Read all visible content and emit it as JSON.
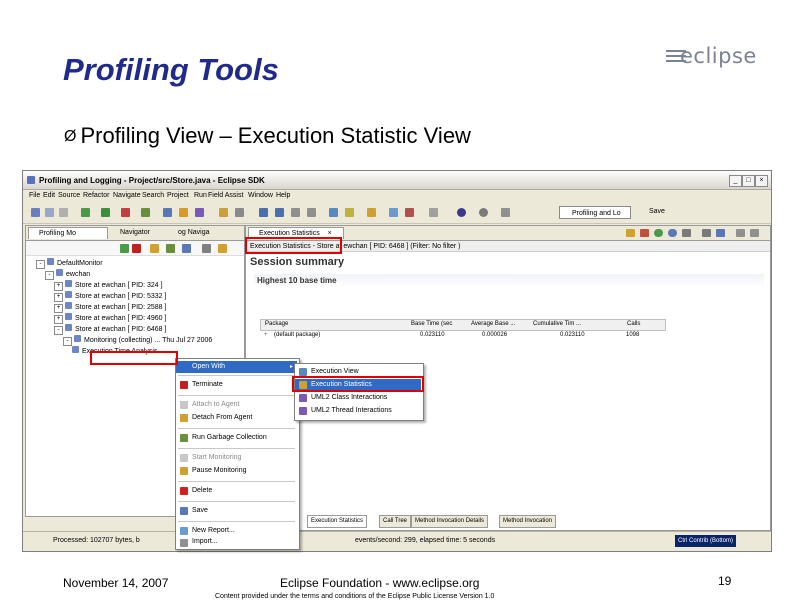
{
  "slide": {
    "title": "Profiling Tools",
    "logo_text": "eclipse",
    "bullet_marker": "Ø",
    "bullet": "Profiling View – Execution Statistic View"
  },
  "window": {
    "title": "Profiling and Logging - Project/src/Store.java - Eclipse SDK",
    "controls": [
      "_",
      "□",
      "×"
    ]
  },
  "menubar": [
    "File",
    "Edit",
    "Source",
    "Refactor",
    "Navigate",
    "Search",
    "Project",
    "Run",
    "Field Assist",
    "Window",
    "Help"
  ],
  "perspective": {
    "label": "Profiling and Lo",
    "save": "Save"
  },
  "left_pane": {
    "tabs": [
      "Profiling Mo",
      "Navigator",
      "og Naviga"
    ],
    "tree": [
      {
        "indent": 0,
        "exp": "-",
        "label": "DefaultMonitor"
      },
      {
        "indent": 1,
        "exp": "-",
        "label": "ewchan"
      },
      {
        "indent": 2,
        "exp": "+",
        "label": "Store at ewchan [ PID: 324 ]"
      },
      {
        "indent": 2,
        "exp": "+",
        "label": "Store at ewchan [ PID: 5332 ]"
      },
      {
        "indent": 2,
        "exp": "+",
        "label": "Store at ewchan [ PID: 2588 ]"
      },
      {
        "indent": 2,
        "exp": "+",
        "label": "Store at ewchan [ PID: 4960 ]"
      },
      {
        "indent": 2,
        "exp": "-",
        "label": "Store at ewchan [ PID: 6468 ]"
      },
      {
        "indent": 3,
        "exp": "-",
        "label": "Monitoring (collecting) ... Thu Jul 27 2006"
      },
      {
        "indent": 4,
        "exp": "",
        "label": "Execution Time Analysis"
      }
    ]
  },
  "right_pane": {
    "tab": "Execution Statistics",
    "tab_close": "×",
    "header": "Execution Statistics - Store at ewchan [ PID: 6468 ]  (Filter: No filter )",
    "session": "Session summary",
    "section": "Highest 10 base time",
    "columns": [
      "Package",
      "Base Time (sec",
      "Average Base ...",
      "Cumulative Tim ...",
      "Calls"
    ],
    "row": [
      "(default package)",
      "0.023110",
      "0.000026",
      "0.023110",
      "1098"
    ],
    "bottom_tabs": [
      "Execution Statistics",
      "Call Tree",
      "Method Invocation Details",
      "Method Invocation"
    ]
  },
  "context_menu": {
    "items": [
      {
        "label": "Open With",
        "hl": true,
        "dis": false,
        "sub": "▸"
      },
      {
        "label": "Terminate",
        "hl": false,
        "dis": false
      },
      {
        "label": "Attach to Agent",
        "hl": false,
        "dis": true
      },
      {
        "label": "Detach From Agent",
        "hl": false,
        "dis": false
      },
      {
        "label": "Run Garbage Collection",
        "hl": false,
        "dis": false
      },
      {
        "label": "Start Monitoring",
        "hl": false,
        "dis": true
      },
      {
        "label": "Pause Monitoring",
        "hl": false,
        "dis": false
      },
      {
        "label": "Delete",
        "hl": false,
        "dis": false
      },
      {
        "label": "Save",
        "hl": false,
        "dis": false
      },
      {
        "label": "New Report...",
        "hl": false,
        "dis": false
      },
      {
        "label": "Import...",
        "hl": false,
        "dis": false
      }
    ]
  },
  "submenu": {
    "items": [
      {
        "label": "Execution View",
        "hl": false
      },
      {
        "label": "Execution Statistics",
        "hl": true
      },
      {
        "label": "UML2 Class Interactions",
        "hl": false
      },
      {
        "label": "UML2 Thread Interactions",
        "hl": false
      }
    ]
  },
  "statusbar": {
    "left": "Processed: 102707 bytes, b",
    "right": "events/second: 299, elapsed time: 5 seconds",
    "badge": "Ctrl Contrib (Bottom)"
  },
  "footer": {
    "date": "November 14, 2007",
    "center": "Eclipse Foundation - www.eclipse.org",
    "page": "19",
    "license": "Content provided under the terms and conditions of the Eclipse Public License Version 1.0"
  },
  "colors": {
    "title": "#1f2a8c",
    "callout": "#e00000",
    "highlight": "#316ac5"
  }
}
